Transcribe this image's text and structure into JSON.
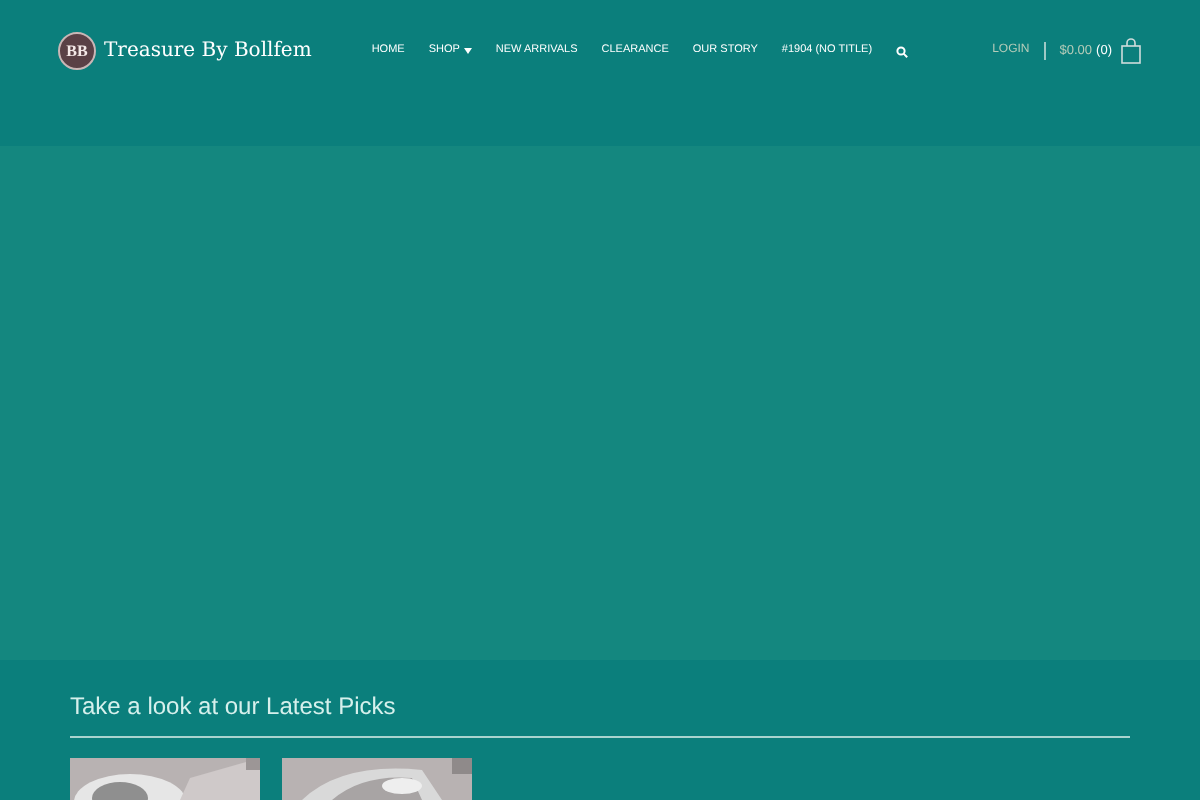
{
  "header": {
    "logo_mark": "BB",
    "site_title": "Treasure By Bollfem",
    "nav": [
      {
        "label": "HOME",
        "has_dropdown": false
      },
      {
        "label": "SHOP",
        "has_dropdown": true
      },
      {
        "label": "NEW ARRIVALS",
        "has_dropdown": false
      },
      {
        "label": "CLEARANCE",
        "has_dropdown": false
      },
      {
        "label": "OUR STORY",
        "has_dropdown": false
      },
      {
        "label": "#1904 (NO TITLE)",
        "has_dropdown": false
      }
    ],
    "login": "LOGIN",
    "cart_total": "$0.00",
    "cart_count": "(0)"
  },
  "latest": {
    "heading": "Take a look at our Latest Picks"
  }
}
